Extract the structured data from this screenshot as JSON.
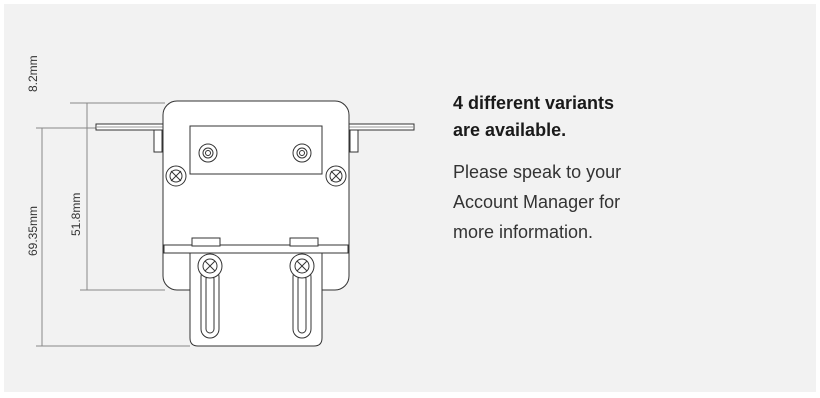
{
  "dimensions": {
    "top_flange": "8.2mm",
    "total_height": "69.35mm",
    "body_height": "51.8mm"
  },
  "info": {
    "heading_lines": [
      "4 different variants",
      "are available."
    ],
    "body_lines": [
      "Please speak to your",
      "Account Manager for",
      "more information."
    ]
  }
}
